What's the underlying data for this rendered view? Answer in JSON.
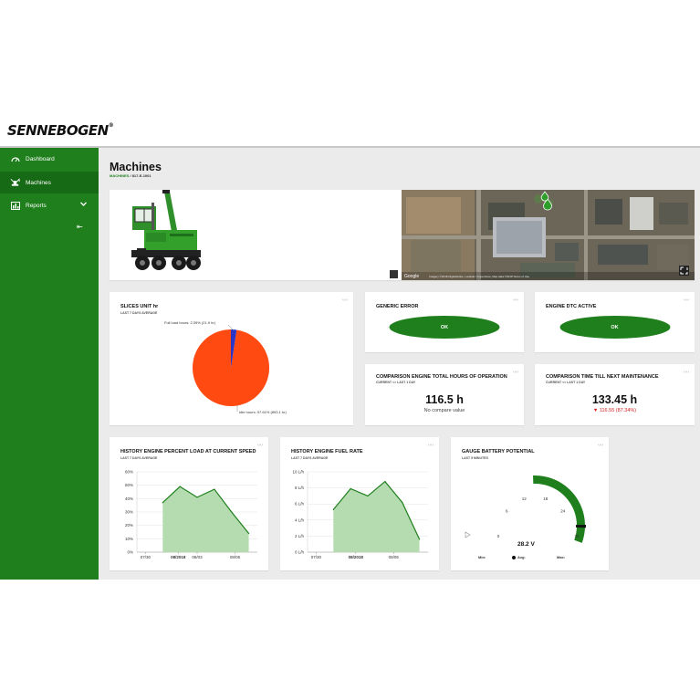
{
  "brand": {
    "logo_text": "SENNEBOGEN",
    "reg": "®"
  },
  "sidebar": {
    "items": [
      {
        "label": "Dashboard",
        "icon": "gauge-icon"
      },
      {
        "label": "Machines",
        "icon": "excavator-icon",
        "active": true
      },
      {
        "label": "Reports",
        "icon": "bar-chart-icon"
      }
    ],
    "collapse_glyph": "⇤"
  },
  "page": {
    "title": "Machines",
    "crumb_root": "MACHINES",
    "crumb_sep": " / ",
    "crumb_leaf": "817-E-1001"
  },
  "map": {
    "provider_label": "Google",
    "attribution": "Imagery ©2018 DigitalGlobe, Landsat / Copernicus, Map data ©2018  Terms of Use"
  },
  "cards": {
    "slices": {
      "title": "SLICES  UNIT hr",
      "subtitle": "LAST 7 DAYS AVERAGE",
      "label_full": "Full load hours: 2.39% (21.9 hr)",
      "label_idle": "Idle hours: 97.61% (893.1 hr)"
    },
    "generic_error": {
      "title": "GENERIC ERROR",
      "status": "OK"
    },
    "engine_dtc": {
      "title": "ENGINE DTC ACTIVE",
      "status": "OK"
    },
    "compare_hours": {
      "title": "COMPARISON ENGINE TOTAL HOURS OF OPERATION",
      "subtitle": "CURRENT <> LAST 1 DAY",
      "value": "116.5 h",
      "note": "No compare value"
    },
    "compare_maint": {
      "title": "COMPARISON TIME TILL NEXT MAINTENANCE",
      "subtitle": "CURRENT <> LAST 1 DAY",
      "value": "133.45 h",
      "delta": "▼ 116.55 (87.34%)"
    },
    "load_history": {
      "title": "HISTORY ENGINE PERCENT LOAD AT CURRENT SPEED",
      "subtitle": "LAST 7 DAYS AVERAGE"
    },
    "fuel_history": {
      "title": "HISTORY ENGINE FUEL RATE",
      "subtitle": "LAST 7 DAYS AVERAGE"
    },
    "battery": {
      "title": "GAUGE BATTERY POTENTIAL",
      "subtitle": "LAST 5 MINUTES",
      "value": "28.2 V",
      "min_label": "Min:",
      "avg_label": "Avg:",
      "max_label": "Max:",
      "ticks": [
        "0",
        "6",
        "12",
        "18",
        "24",
        "30"
      ]
    }
  },
  "colors": {
    "brand_green": "#1e7f1c",
    "pie_idle": "#ff4a12",
    "pie_full": "#2a35c8",
    "area_fill": "#b5dcb0",
    "line": "#1e7f1c"
  },
  "chart_data": [
    {
      "type": "pie",
      "title": "SLICES  UNIT hr",
      "slices": [
        {
          "name": "Idle hours",
          "value": 97.61,
          "hours": 893.1
        },
        {
          "name": "Full load hours",
          "value": 2.39,
          "hours": 21.9
        }
      ]
    },
    {
      "type": "area",
      "title": "HISTORY ENGINE PERCENT LOAD AT CURRENT SPEED",
      "x": [
        0,
        1,
        2,
        3,
        4,
        5
      ],
      "x_ticks": [
        {
          "at": -1,
          "label": "07/30"
        },
        {
          "at": 0.9,
          "label": "08/2018",
          "bold": true
        },
        {
          "at": 2,
          "label": "08/03"
        },
        {
          "at": 4.2,
          "label": "08/05"
        }
      ],
      "xlim": [
        -1.5,
        5.5
      ],
      "values": [
        37,
        49,
        41,
        47,
        30,
        14
      ],
      "ylim": [
        0,
        60
      ],
      "y_ticks": [
        "0%",
        "10%",
        "20%",
        "30%",
        "40%",
        "50%",
        "60%"
      ],
      "grid": true
    },
    {
      "type": "area",
      "title": "HISTORY ENGINE FUEL RATE",
      "x": [
        0,
        1,
        2,
        3,
        4,
        5
      ],
      "x_ticks": [
        {
          "at": -1,
          "label": "07/30"
        },
        {
          "at": 1.3,
          "label": "08/2018",
          "bold": true
        },
        {
          "at": 3.5,
          "label": "08/05"
        }
      ],
      "xlim": [
        -1.5,
        5.5
      ],
      "values": [
        5.3,
        7.9,
        7,
        8.8,
        6.2,
        1.6
      ],
      "ylim": [
        0,
        10
      ],
      "y_ticks": [
        "0 L/h",
        "2 L/h",
        "4 L/h",
        "6 L/h",
        "8 L/h",
        "10 L/h"
      ],
      "grid": true
    },
    {
      "type": "gauge",
      "title": "GAUGE BATTERY POTENTIAL",
      "value": 28.2,
      "min": 0,
      "max": 30,
      "band": [
        18,
        30
      ]
    }
  ]
}
